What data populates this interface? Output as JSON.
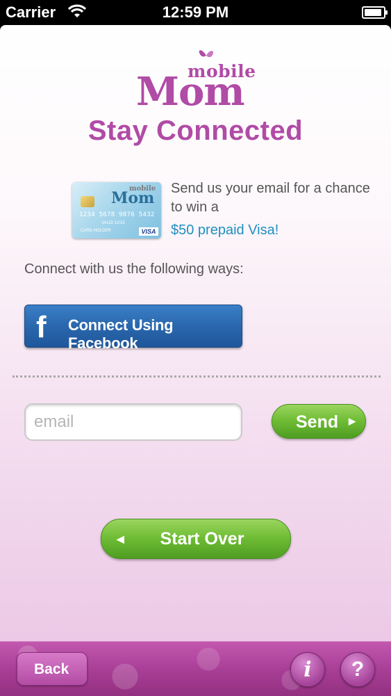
{
  "status_bar": {
    "carrier": "Carrier",
    "time": "12:59 PM"
  },
  "logo": {
    "mobile": "mobile",
    "mom": "Mom"
  },
  "title": "Stay Connected",
  "promo": {
    "card": {
      "mobile": "mobile",
      "mom": "Mom",
      "number": "1234 5678 9876 5432",
      "valid": "VALID 12/15",
      "holder": "CARD HOLDER",
      "visa": "VISA"
    },
    "text": "Send us your email for a chance to win a",
    "prize": "$50 prepaid Visa!"
  },
  "connect_label": "Connect with us the following ways:",
  "facebook_button": {
    "icon": "f",
    "label": "Connect Using Facebook"
  },
  "email": {
    "value": "",
    "placeholder": "email"
  },
  "send_button": {
    "label": "Send",
    "arrow": "▶"
  },
  "start_over_button": {
    "label": "Start Over",
    "arrow": "◀"
  },
  "toolbar": {
    "back_label": "Back",
    "info_glyph": "i",
    "help_glyph": "?"
  },
  "colors": {
    "brand_purple": "#b04ba6",
    "link_blue": "#1f8fc0",
    "facebook_blue": "#2a67ad",
    "button_green": "#6dbb33"
  }
}
